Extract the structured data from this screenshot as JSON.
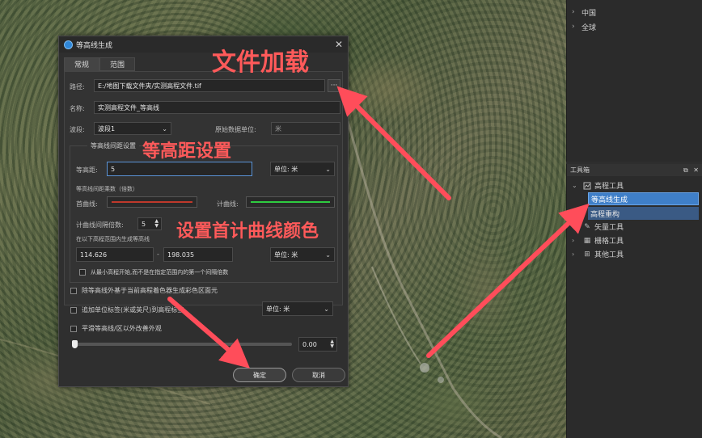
{
  "region_tree": [
    {
      "label": "中国"
    },
    {
      "label": "全球"
    }
  ],
  "toolbox": {
    "title": "工具箱",
    "ctrl_float": "⧉",
    "ctrl_close": "✕",
    "groups": [
      {
        "label": "高程工具",
        "expanded": true,
        "icon": "terrain-tool-icon",
        "items": [
          {
            "label": "等高线生成",
            "selected": true
          },
          {
            "label": "高程重构",
            "selected": false
          }
        ]
      },
      {
        "label": "矢量工具",
        "icon": "pen-icon"
      },
      {
        "label": "栅格工具",
        "icon": "grid-icon"
      },
      {
        "label": "其他工具",
        "icon": "tiles-icon"
      }
    ]
  },
  "dialog": {
    "title": "等高线生成",
    "tabs": [
      "常规",
      "范围"
    ],
    "path_label": "路径:",
    "path_value": "E:/地图下载文件夹/实测高程文件.tif",
    "browse_label": "···",
    "name_label": "名称:",
    "name_value": "实测高程文件_等高线",
    "band_label": "波段:",
    "band_value": "波段1",
    "orig_unit_label": "原始数据单位:",
    "orig_unit_value": "米",
    "group_title": "等高线间距设置",
    "interval_label": "等高距:",
    "interval_value": "5",
    "interval_unit": "单位: 米",
    "multiplier_title": "等高线间距乘数（倍数）",
    "first_curve_label": "首曲线:",
    "index_curve_label": "计曲线:",
    "first_curve_color": "#c0392b",
    "index_curve_color": "#2ecc40",
    "index_multiple_label": "计曲线间隔倍数:",
    "index_multiple_value": "5",
    "range_title": "在以下高程范围内生成等高线",
    "range_min": "114.626",
    "range_sep": "-",
    "range_max": "198.035",
    "range_unit": "单位: 米",
    "start_from_min_label": "从最小高程开始,而不是在指定范围内的第一个间隔倍数",
    "exclude_label": "除等高线外基于当前高程着色器生成彩色区面元",
    "add_unit_label": "追加单位标签(米或英尺)到高程标签",
    "add_unit_unit": "单位: 米",
    "smooth_label": "平滑等高线/区以外改善外观",
    "smooth_value": "0.00",
    "smooth_fraction": 0.0,
    "ok_label": "确定",
    "cancel_label": "取消"
  },
  "annotations": {
    "file_load": "文件加载",
    "interval_setting": "等高距设置",
    "curve_color": "设置首计曲线颜色",
    "color": "#ff5a5a"
  }
}
